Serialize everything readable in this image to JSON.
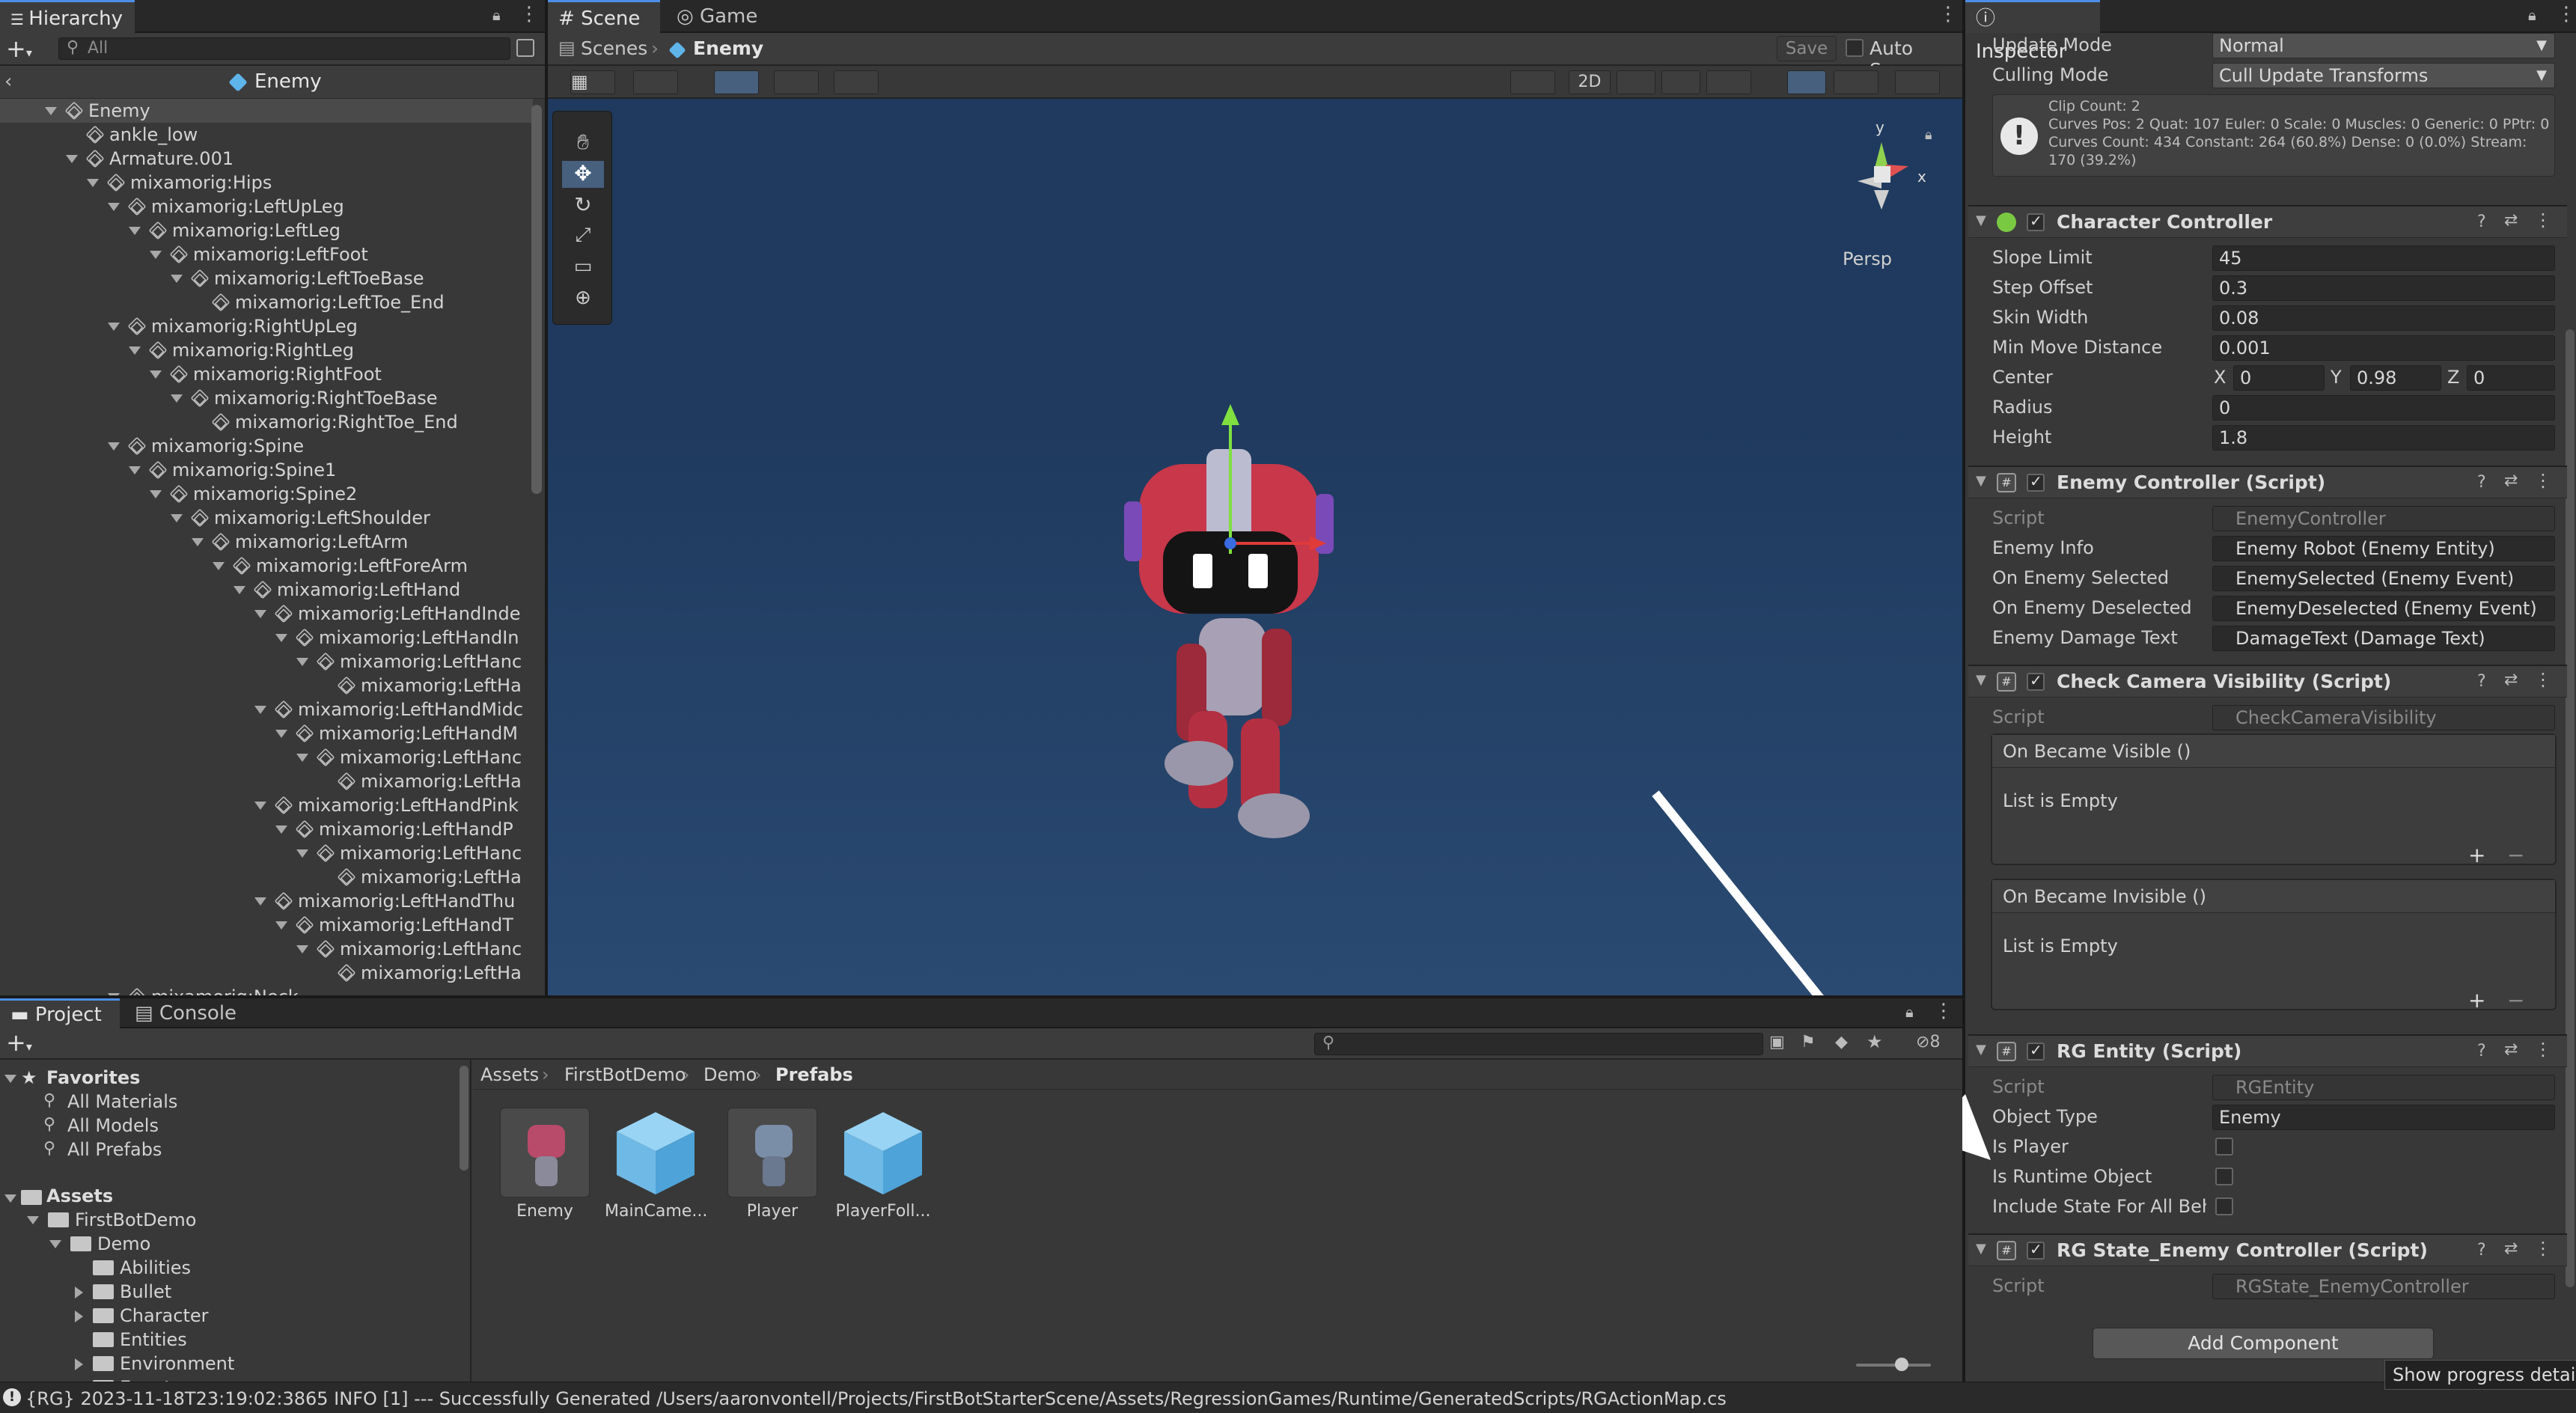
{
  "hierarchy": {
    "tab": "Hierarchy",
    "search_placeholder": "All",
    "prefab_title": "Enemy",
    "items": [
      {
        "label": "Enemy",
        "depth": 0,
        "fold": true
      },
      {
        "label": "ankle_low",
        "depth": 1,
        "fold": false
      },
      {
        "label": "Armature.001",
        "depth": 1,
        "fold": true
      },
      {
        "label": "mixamorig:Hips",
        "depth": 2,
        "fold": true
      },
      {
        "label": "mixamorig:LeftUpLeg",
        "depth": 3,
        "fold": true
      },
      {
        "label": "mixamorig:LeftLeg",
        "depth": 4,
        "fold": true
      },
      {
        "label": "mixamorig:LeftFoot",
        "depth": 5,
        "fold": true
      },
      {
        "label": "mixamorig:LeftToeBase",
        "depth": 6,
        "fold": true
      },
      {
        "label": "mixamorig:LeftToe_End",
        "depth": 7,
        "fold": false
      },
      {
        "label": "mixamorig:RightUpLeg",
        "depth": 3,
        "fold": true
      },
      {
        "label": "mixamorig:RightLeg",
        "depth": 4,
        "fold": true
      },
      {
        "label": "mixamorig:RightFoot",
        "depth": 5,
        "fold": true
      },
      {
        "label": "mixamorig:RightToeBase",
        "depth": 6,
        "fold": true
      },
      {
        "label": "mixamorig:RightToe_End",
        "depth": 7,
        "fold": false
      },
      {
        "label": "mixamorig:Spine",
        "depth": 3,
        "fold": true
      },
      {
        "label": "mixamorig:Spine1",
        "depth": 4,
        "fold": true
      },
      {
        "label": "mixamorig:Spine2",
        "depth": 5,
        "fold": true
      },
      {
        "label": "mixamorig:LeftShoulder",
        "depth": 6,
        "fold": true
      },
      {
        "label": "mixamorig:LeftArm",
        "depth": 7,
        "fold": true
      },
      {
        "label": "mixamorig:LeftForeArm",
        "depth": 8,
        "fold": true
      },
      {
        "label": "mixamorig:LeftHand",
        "depth": 9,
        "fold": true
      },
      {
        "label": "mixamorig:LeftHandInde",
        "depth": 10,
        "fold": true
      },
      {
        "label": "mixamorig:LeftHandIn",
        "depth": 11,
        "fold": true
      },
      {
        "label": "mixamorig:LeftHanc",
        "depth": 12,
        "fold": true
      },
      {
        "label": "mixamorig:LeftHa",
        "depth": 13,
        "fold": false
      },
      {
        "label": "mixamorig:LeftHandMidc",
        "depth": 10,
        "fold": true
      },
      {
        "label": "mixamorig:LeftHandM",
        "depth": 11,
        "fold": true
      },
      {
        "label": "mixamorig:LeftHanc",
        "depth": 12,
        "fold": true
      },
      {
        "label": "mixamorig:LeftHa",
        "depth": 13,
        "fold": false
      },
      {
        "label": "mixamorig:LeftHandPink",
        "depth": 10,
        "fold": true
      },
      {
        "label": "mixamorig:LeftHandP",
        "depth": 11,
        "fold": true
      },
      {
        "label": "mixamorig:LeftHanc",
        "depth": 12,
        "fold": true
      },
      {
        "label": "mixamorig:LeftHa",
        "depth": 13,
        "fold": false
      },
      {
        "label": "mixamorig:LeftHandThu",
        "depth": 10,
        "fold": true
      },
      {
        "label": "mixamorig:LeftHandT",
        "depth": 11,
        "fold": true
      },
      {
        "label": "mixamorig:LeftHanc",
        "depth": 12,
        "fold": true
      },
      {
        "label": "mixamorig:LeftHa",
        "depth": 13,
        "fold": false
      },
      {
        "label": "mixamorig:Neck",
        "depth": 3,
        "fold": true
      }
    ]
  },
  "scene": {
    "tab_scene": "Scene",
    "tab_game": "Game",
    "breadcrumb_root": "Scenes",
    "breadcrumb_current": "Enemy",
    "save": "Save",
    "auto_save": "Auto Save",
    "toggle_2d": "2D",
    "persp": "Persp",
    "gizmo_y": "y",
    "gizmo_x": "x"
  },
  "inspector": {
    "tab": "Inspector",
    "update_mode_label": "Update Mode",
    "update_mode": "Normal",
    "culling_mode_label": "Culling Mode",
    "culling_mode": "Cull Update Transforms",
    "info_lines": [
      "Clip Count: 2",
      "Curves Pos: 2 Quat: 107 Euler: 0 Scale: 0 Muscles: 0 Generic: 0 PPtr: 0",
      "Curves Count: 434 Constant: 264 (60.8%) Dense: 0 (0.0%) Stream:",
      "170 (39.2%)"
    ],
    "cc": {
      "title": "Character Controller",
      "fields": [
        {
          "label": "Slope Limit",
          "value": "45"
        },
        {
          "label": "Step Offset",
          "value": "0.3"
        },
        {
          "label": "Skin Width",
          "value": "0.08"
        },
        {
          "label": "Min Move Distance",
          "value": "0.001"
        }
      ],
      "center_label": "Center",
      "cx": "0",
      "cy": "0.98",
      "cz": "0",
      "lx": "X",
      "ly": "Y",
      "lz": "Z",
      "radius_label": "Radius",
      "radius": "0",
      "height_label": "Height",
      "height": "1.8"
    },
    "ec": {
      "title": "Enemy Controller (Script)",
      "script_label": "Script",
      "script": "EnemyController",
      "fields": [
        {
          "label": "Enemy Info",
          "value": "Enemy Robot (Enemy Entity)"
        },
        {
          "label": "On Enemy Selected",
          "value": "EnemySelected (Enemy Event)"
        },
        {
          "label": "On Enemy Deselected",
          "value": "EnemyDeselected (Enemy Event)"
        },
        {
          "label": "Enemy Damage Text",
          "value": "DamageText (Damage Text)"
        }
      ]
    },
    "ccv": {
      "title": "Check Camera Visibility (Script)",
      "script_label": "Script",
      "script": "CheckCameraVisibility",
      "ev1": "On Became Visible ()",
      "ev2": "On Became Invisible ()",
      "empty": "List is Empty",
      "plus": "+",
      "minus": "−"
    },
    "rg": {
      "title": "RG Entity (Script)",
      "script_label": "Script",
      "script": "RGEntity",
      "object_type_label": "Object Type",
      "object_type": "Enemy",
      "is_player": "Is Player",
      "is_runtime": "Is Runtime Object",
      "include_state": "Include State For All Beha"
    },
    "rgs": {
      "title": "RG State_Enemy Controller (Script)",
      "script_label": "Script",
      "script": "RGState_EnemyController"
    },
    "add_component": "Add Component"
  },
  "project": {
    "tab_project": "Project",
    "tab_console": "Console",
    "hidden_count": "8",
    "favorites": "Favorites",
    "fav_items": [
      "All Materials",
      "All Models",
      "All Prefabs"
    ],
    "assets": "Assets",
    "tree": [
      {
        "label": "FirstBotDemo",
        "depth": 1,
        "fold": true
      },
      {
        "label": "Demo",
        "depth": 2,
        "fold": true
      },
      {
        "label": "Abilities",
        "depth": 3,
        "fold": false
      },
      {
        "label": "Bullet",
        "depth": 3,
        "fold": "closed"
      },
      {
        "label": "Character",
        "depth": 3,
        "fold": "closed"
      },
      {
        "label": "Entities",
        "depth": 3,
        "fold": false
      },
      {
        "label": "Environment",
        "depth": 3,
        "fold": "closed"
      },
      {
        "label": "Events",
        "depth": 3,
        "fold": "closed"
      }
    ],
    "breadcrumb": [
      "Assets",
      "FirstBotDemo",
      "Demo",
      "Prefabs"
    ],
    "assets_grid": [
      {
        "name": "Enemy",
        "kind": "robot-red"
      },
      {
        "name": "MainCame...",
        "kind": "cube"
      },
      {
        "name": "Player",
        "kind": "robot-blue"
      },
      {
        "name": "PlayerFoll...",
        "kind": "cube"
      }
    ]
  },
  "status": {
    "text": "{RG} 2023-11-18T23:19:02:3865  INFO [1] --- Successfully Generated /Users/aaronvontell/Projects/FirstBotStarterScene/Assets/RegressionGames/Runtime/GeneratedScripts/RGActionMap.cs",
    "tooltip": "Show progress details"
  },
  "colors": {
    "accent": "#4d8ee8",
    "scene_bg": "#1f3a5e",
    "arrow": "#ffffff"
  }
}
